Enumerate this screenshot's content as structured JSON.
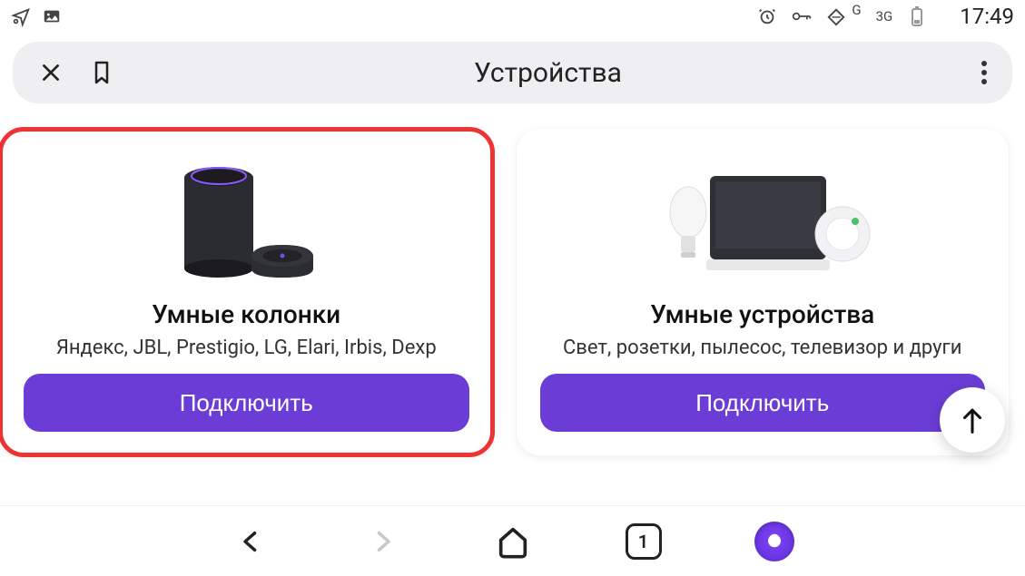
{
  "status": {
    "signal1": "G",
    "signal2": "3G",
    "time": "17:49"
  },
  "addressbar": {
    "title": "Устройства"
  },
  "cards": [
    {
      "title": "Умные колонки",
      "subtitle": "Яндекс, JBL, Prestigio, LG, Elari, Irbis, Dexp",
      "button": "Подключить"
    },
    {
      "title": "Умные устройства",
      "subtitle": "Свет, розетки, пылесос, телевизор и други",
      "button": "Подключить"
    }
  ],
  "bottomnav": {
    "tab_count": "1"
  }
}
